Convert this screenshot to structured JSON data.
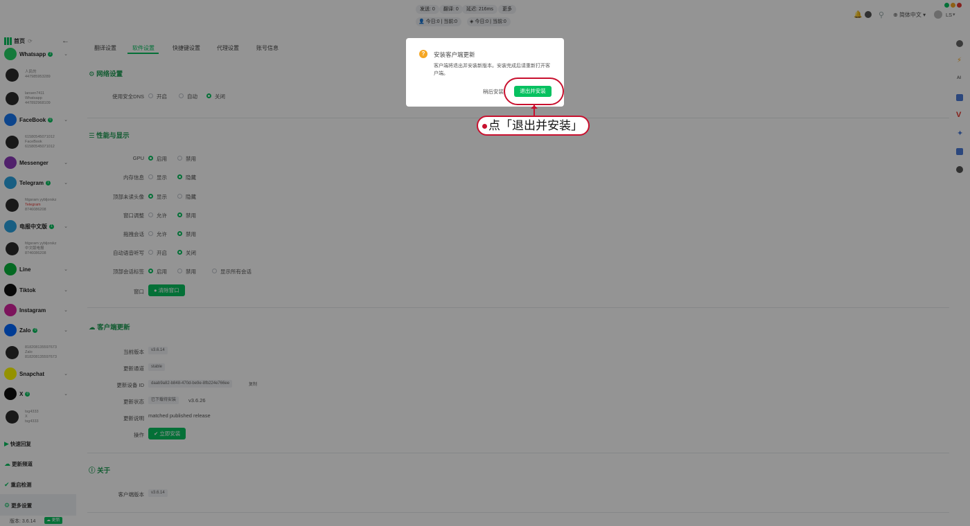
{
  "topbar": {
    "stats_row1": [
      "发送: 0",
      "翻译: 0",
      "延迟: 216ms",
      "更多"
    ],
    "stats_row2": [
      "今日:0 | 当前:0",
      "今日:0 | 当前:0"
    ],
    "language": "简体中文",
    "user": "LS"
  },
  "sidebar": {
    "home": "首页",
    "platforms": [
      {
        "name": "Whatsapp",
        "badge": "2",
        "color": "#25d366"
      },
      {
        "name": "FaceBook",
        "badge": "0",
        "color": "#1877f2"
      },
      {
        "name": "Messenger",
        "badge": "",
        "color": "#8a3ab9"
      },
      {
        "name": "Telegram",
        "badge": "1",
        "color": "#2aa3e0"
      },
      {
        "name": "电报中文版",
        "badge": "1",
        "color": "#2aa3e0"
      },
      {
        "name": "Line",
        "badge": "",
        "color": "#07b53b"
      },
      {
        "name": "Tiktok",
        "badge": "",
        "color": "#111111"
      },
      {
        "name": "Instagram",
        "badge": "",
        "color": "#d6249f"
      },
      {
        "name": "Zalo",
        "badge": "0",
        "color": "#0068ff"
      },
      {
        "name": "Snapchat",
        "badge": "",
        "color": "#fffc00"
      },
      {
        "name": "X",
        "badge": "0",
        "color": "#111111"
      }
    ],
    "accounts": [
      {
        "lines": [
          "人民的",
          "447985953289"
        ]
      },
      {
        "lines": [
          "lansen7411",
          "Whatsapp",
          "447892968109"
        ]
      },
      {
        "lines": [
          "61580545071012",
          "FaceBook",
          "61580545071012"
        ]
      },
      {
        "lines": [
          "fdgsram yybljorskz",
          "Telegram",
          "8746086208"
        ]
      },
      {
        "lines": [
          "fdgsram yybljorskz",
          "中文版电报",
          "8746086208"
        ]
      },
      {
        "lines": [
          "818208135597673",
          "Zalo",
          "818208135597673"
        ]
      },
      {
        "lines": [
          "tsg4333",
          "X",
          "tsg4333"
        ]
      }
    ],
    "bottom_items": [
      "快速回复",
      "更新频道",
      "重启检测",
      "更多设置"
    ],
    "version": "版本: 3.6.14",
    "update_tag": "更新"
  },
  "main": {
    "tabs": [
      "翻译设置",
      "软件设置",
      "快捷键设置",
      "代理设置",
      "账号信息"
    ],
    "network": {
      "title": "网络设置",
      "label": "使用安全DNS",
      "options": [
        "开启",
        "自动",
        "关闭"
      ]
    },
    "perf": {
      "title": "性能与显示",
      "rows": [
        {
          "label": "GPU",
          "options": [
            "启用",
            "禁用"
          ]
        },
        {
          "label": "内存信息",
          "options": [
            "显示",
            "隐藏"
          ]
        },
        {
          "label": "顶部未读头像",
          "options": [
            "显示",
            "隐藏"
          ]
        },
        {
          "label": "窗口调整",
          "options": [
            "允许",
            "禁用"
          ]
        },
        {
          "label": "拖拽会话",
          "options": [
            "允许",
            "禁用"
          ]
        },
        {
          "label": "自动语音听写",
          "options": [
            "开启",
            "关闭"
          ]
        },
        {
          "label": "顶部会话标签",
          "options": [
            "启用",
            "禁用",
            "显示所有会话"
          ]
        }
      ],
      "window_label": "窗口",
      "window_button": "清除窗口"
    },
    "update": {
      "title": "客户端更新",
      "current_version_label": "当前版本",
      "current_version_value": "v3.6.14",
      "channel_label": "更新通道",
      "channel_value": "stable",
      "device_label": "更新设备 ID",
      "device_value": "daab9a82-b848-470d-be9e-8fb224e766ee",
      "copy": "复制",
      "status_label": "更新状态",
      "status_tag": "已下载待安装",
      "status_version": "v3.6.26",
      "desc_label": "更新说明",
      "desc_value": "matched published release",
      "op_label": "操作",
      "op_button": "立即安装"
    },
    "about": {
      "title": "关于",
      "label": "客户端版本",
      "value": "v3.6.14"
    }
  },
  "dialog": {
    "title": "安装客户端更新",
    "body": "客户端将退出并安装新版本。安装完成后请重新打开客户端。",
    "later": "稍后安装",
    "confirm": "退出并安装"
  },
  "callout": {
    "text": "点「退出并安装」",
    "color": "#c8102e"
  }
}
